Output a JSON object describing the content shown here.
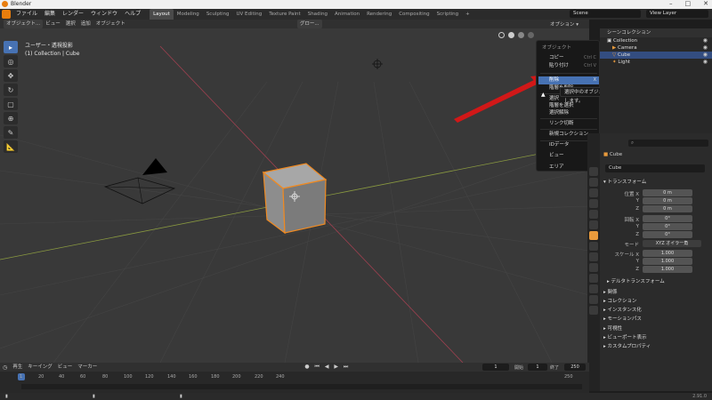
{
  "app": {
    "title": "Blender"
  },
  "menu": [
    "ファイル",
    "編集",
    "レンダー",
    "ウィンドウ",
    "ヘルプ"
  ],
  "workspaces": [
    "Layout",
    "Modeling",
    "Sculpting",
    "UV Editing",
    "Texture Paint",
    "Shading",
    "Animation",
    "Rendering",
    "Compositing",
    "Scripting"
  ],
  "workspace_add": "+",
  "top_right": {
    "scene": "Scene",
    "view_layer": "View Layer"
  },
  "viewport_header": {
    "mode": "オブジェクト...",
    "menu": [
      "ビュー",
      "選択",
      "追加",
      "オブジェクト"
    ],
    "transform": "グロー..."
  },
  "viewport_info": {
    "line1": "ユーザー・透視投影",
    "line2": "(1) Collection | Cube"
  },
  "options_btn": "オプション ▾",
  "context_menu": {
    "title": "オブジェクト",
    "items": [
      {
        "label": "コピー",
        "shortcut": "Ctrl C"
      },
      {
        "label": "貼り付け",
        "shortcut": "Ctrl V"
      },
      {
        "label": "削除",
        "shortcut": "X"
      },
      {
        "label": "階層を削除",
        "shortcut": ""
      },
      {
        "label": "選択",
        "shortcut": ""
      },
      {
        "label": "階層を選択",
        "shortcut": ""
      },
      {
        "label": "選択解除",
        "shortcut": ""
      },
      {
        "label": "リンク切断",
        "shortcut": ""
      },
      {
        "label": "新規コレクション",
        "shortcut": ""
      },
      {
        "label": "IDデータ",
        "shortcut": "▸"
      },
      {
        "label": "ビュー",
        "shortcut": "▸"
      },
      {
        "label": "エリア",
        "shortcut": "▸"
      }
    ]
  },
  "tooltip": "選択中のオブジェクトとコレクションを削除します。",
  "outliner": {
    "header": "シーンコレクション",
    "rows": [
      {
        "label": "Collection"
      },
      {
        "label": "Camera"
      },
      {
        "label": "Cube"
      },
      {
        "label": "Light"
      }
    ]
  },
  "properties": {
    "object_name": "Cube",
    "data_name": "Cube",
    "transform_title": "トランスフォーム",
    "location": {
      "label": "位置 X",
      "x": "0 m",
      "y": "0 m",
      "z": "0 m"
    },
    "rotation": {
      "label": "回転 X",
      "x": "0°",
      "y": "0°",
      "z": "0°"
    },
    "mode_label": "モード",
    "mode_value": "XYZ オイラー角",
    "scale": {
      "label": "スケール X",
      "x": "1.000",
      "y": "1.000",
      "z": "1.000"
    },
    "axis_y": "Y",
    "axis_z": "Z",
    "sections": [
      "デルタトランスフォーム",
      "関係",
      "コレクション",
      "インスタンス化",
      "モーションパス",
      "可視性",
      "ビューポート表示",
      "カスタムプロパティ"
    ]
  },
  "timeline": {
    "menu": [
      "再生",
      "キーイング",
      "ビュー",
      "マーカー"
    ],
    "current_frame": "1",
    "start_label": "開始",
    "start": "1",
    "end_label": "終了",
    "end": "250",
    "frames": [
      "1",
      "20",
      "40",
      "60",
      "80",
      "100",
      "120",
      "140",
      "160",
      "180",
      "200",
      "220",
      "240",
      "250"
    ]
  },
  "status": {
    "version": "2.91.0"
  }
}
